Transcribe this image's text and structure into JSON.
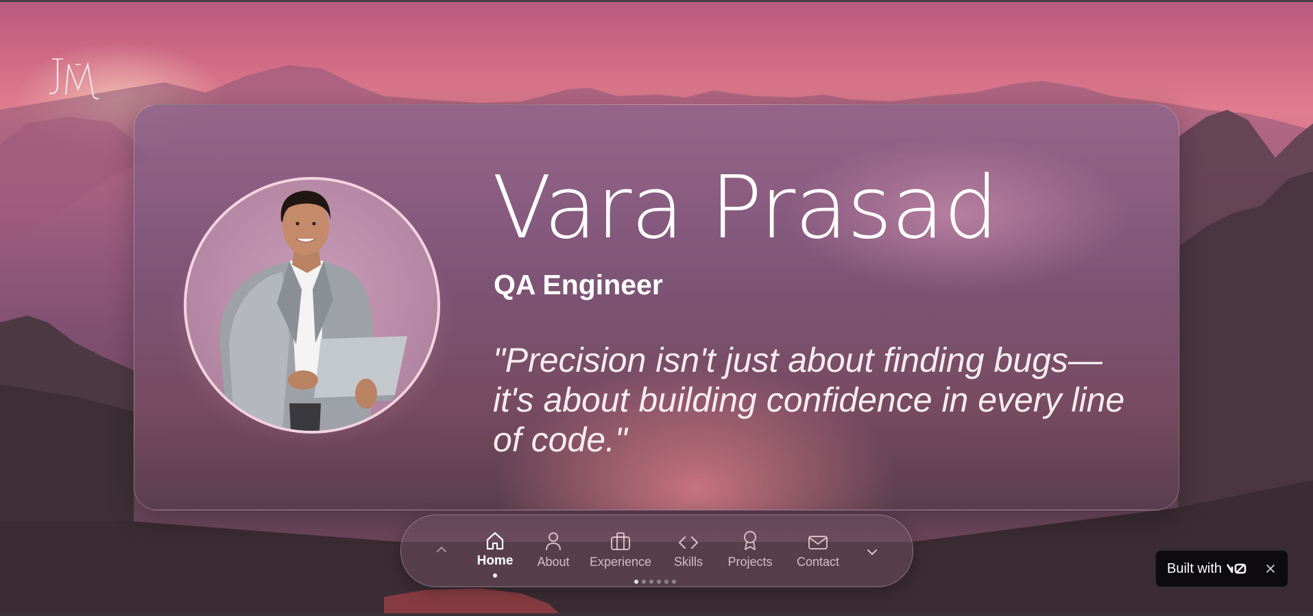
{
  "background": {
    "colors": {
      "sky_top": "#b85a7e",
      "sky_glow": "#e07d8f",
      "mountains": "#47343f"
    }
  },
  "logo": {
    "text": "JM",
    "icon": "jm-monogram-logo"
  },
  "hero": {
    "name": "Vara Prasad",
    "role": "QA Engineer",
    "quote": "\"Precision isn't just about finding bugs—it's about building confidence in every line of code.\"",
    "avatar_icon": "profile-photo-man-with-laptop"
  },
  "nav": {
    "prev_icon": "chevron-up-icon",
    "next_icon": "chevron-down-icon",
    "items": [
      {
        "label": "Home",
        "icon": "home-icon",
        "active": true
      },
      {
        "label": "About",
        "icon": "user-icon",
        "active": false
      },
      {
        "label": "Experience",
        "icon": "briefcase-icon",
        "active": false
      },
      {
        "label": "Skills",
        "icon": "code-icon",
        "active": false
      },
      {
        "label": "Projects",
        "icon": "award-icon",
        "active": false
      },
      {
        "label": "Contact",
        "icon": "mail-icon",
        "active": false
      }
    ],
    "pager": {
      "current": 1,
      "total": 6
    }
  },
  "v0_badge": {
    "text": "Built with",
    "logo": "v0-logo",
    "close_icon": "close-icon"
  }
}
